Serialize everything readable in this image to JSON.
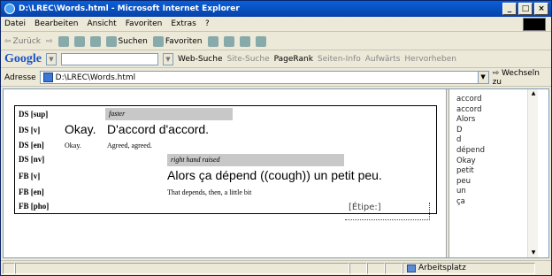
{
  "window": {
    "title": "D:\\LREC\\Words.html - Microsoft Internet Explorer",
    "controls": [
      "_",
      "□",
      "×"
    ]
  },
  "menu": [
    "Datei",
    "Bearbeiten",
    "Ansicht",
    "Favoriten",
    "Extras",
    "?"
  ],
  "toolbar": {
    "back": "Zurück",
    "search": "Suchen",
    "favorites": "Favoriten"
  },
  "google": {
    "logo": "Google",
    "web_search": "Web-Suche",
    "site_search": "Site-Suche",
    "pagerank": "PageRank",
    "page_info": "Seiten-Info",
    "up": "Aufwärts",
    "highlight": "Hervorheben"
  },
  "address": {
    "label": "Adresse",
    "value": "D:\\LREC\\Words.html",
    "go": "Wechseln zu"
  },
  "rows": {
    "ds_sup": {
      "label": "DS [sup]",
      "text": "faster"
    },
    "ds_v": {
      "label": "DS [v]",
      "okay": "Okay.",
      "daccord": "D'accord d'accord."
    },
    "ds_en": {
      "label": "DS [en]",
      "okay": "Okay.",
      "agreed": "Agreed, agreed."
    },
    "ds_nv": {
      "label": "DS [nv]",
      "text": "right hand raised"
    },
    "fb_v": {
      "label": "FB [v]",
      "text": "Alors ça  dépend ((cough)) un petit peu."
    },
    "fb_en": {
      "label": "FB [en]",
      "text": "That depends, then, a little bit"
    },
    "fb_pho": {
      "label": "FB [pho]",
      "tipe": "[Étipe:]"
    }
  },
  "word_list": [
    "accord",
    "accord",
    "Alors",
    "D",
    "d",
    "dépend",
    "Okay",
    "petit",
    "peu",
    "un",
    "ça"
  ],
  "status": {
    "zone": "Arbeitsplatz"
  }
}
